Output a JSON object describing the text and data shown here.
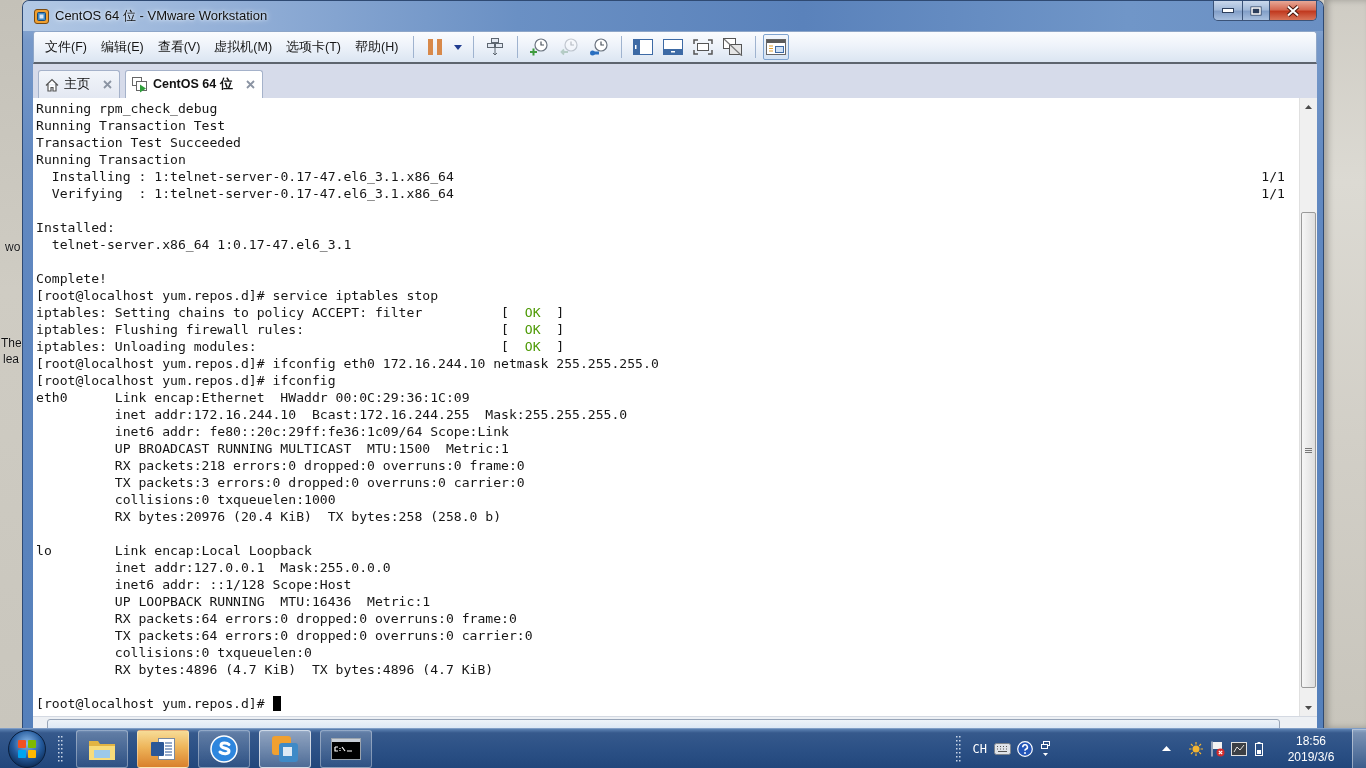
{
  "desktop": {
    "icon_labels": [
      "wo",
      "The",
      "lea"
    ]
  },
  "window": {
    "title": "CentOS 64 位 - VMware Workstation"
  },
  "menu": [
    {
      "label": "文件(F)"
    },
    {
      "label": "编辑(E)"
    },
    {
      "label": "查看(V)"
    },
    {
      "label": "虚拟机(M)"
    },
    {
      "label": "选项卡(T)"
    },
    {
      "label": "帮助(H)"
    }
  ],
  "toolbar": [
    {
      "items": [
        {
          "kind": "pause",
          "disabled": false,
          "pressed": false
        },
        {
          "kind": "dropdown",
          "disabled": false,
          "pressed": false
        }
      ]
    },
    {
      "items": [
        {
          "kind": "send-keys",
          "disabled": false,
          "pressed": false
        }
      ]
    },
    {
      "items": [
        {
          "kind": "snapshot-take",
          "disabled": false,
          "pressed": false
        },
        {
          "kind": "snapshot-revert",
          "disabled": true,
          "pressed": false
        },
        {
          "kind": "snapshot-manager",
          "disabled": false,
          "pressed": false
        }
      ]
    },
    {
      "items": [
        {
          "kind": "library",
          "disabled": false,
          "pressed": false
        },
        {
          "kind": "console",
          "disabled": false,
          "pressed": false
        },
        {
          "kind": "fullscreen",
          "disabled": false,
          "pressed": false
        },
        {
          "kind": "unity",
          "disabled": false,
          "pressed": false
        }
      ]
    },
    {
      "items": [
        {
          "kind": "thumbnails",
          "disabled": false,
          "pressed": true
        }
      ]
    }
  ],
  "tabs": [
    {
      "label": "主页",
      "kind": "home",
      "selected": false
    },
    {
      "label": "CentOS 64 位",
      "kind": "vm",
      "selected": true
    }
  ],
  "terminal": {
    "lines": [
      {
        "kind": "text",
        "text": "Running rpm_check_debug"
      },
      {
        "kind": "text",
        "text": "Running Transaction Test"
      },
      {
        "kind": "text",
        "text": "Transaction Test Succeeded"
      },
      {
        "kind": "text",
        "text": "Running Transaction"
      },
      {
        "kind": "progress",
        "text": "Installing : 1:telnet-server-0.17-47.el6_3.1.x86_64",
        "count": "1/1"
      },
      {
        "kind": "progress",
        "text": "Verifying  : 1:telnet-server-0.17-47.el6_3.1.x86_64",
        "count": "1/1"
      },
      {
        "kind": "blank"
      },
      {
        "kind": "text",
        "text": "Installed:"
      },
      {
        "kind": "item",
        "text": "telnet-server.x86_64 1:0.17-47.el6_3.1"
      },
      {
        "kind": "blank"
      },
      {
        "kind": "text",
        "text": "Complete!"
      },
      {
        "kind": "text",
        "text": "[root@localhost yum.repos.d]# service iptables stop"
      },
      {
        "kind": "status",
        "text": "iptables: Setting chains to policy ACCEPT: filter",
        "open": "[  ",
        "status": "OK",
        "close": "  ]"
      },
      {
        "kind": "status",
        "text": "iptables: Flushing firewall rules:",
        "open": "[  ",
        "status": "OK",
        "close": "  ]"
      },
      {
        "kind": "status",
        "text": "iptables: Unloading modules:",
        "open": "[  ",
        "status": "OK",
        "close": "  ]"
      },
      {
        "kind": "text",
        "text": "[root@localhost yum.repos.d]# ifconfig eth0 172.16.244.10 netmask 255.255.255.0"
      },
      {
        "kind": "text",
        "text": "[root@localhost yum.repos.d]# ifconfig"
      },
      {
        "kind": "interface",
        "name": "eth0",
        "lines": [
          "Link encap:Ethernet  HWaddr 00:0C:29:36:1C:09",
          "inet addr:172.16.244.10  Bcast:172.16.244.255  Mask:255.255.255.0",
          "inet6 addr: fe80::20c:29ff:fe36:1c09/64 Scope:Link",
          "UP BROADCAST RUNNING MULTICAST  MTU:1500  Metric:1",
          "RX packets:218 errors:0 dropped:0 overruns:0 frame:0",
          "TX packets:3 errors:0 dropped:0 overruns:0 carrier:0",
          "collisions:0 txqueuelen:1000",
          "RX bytes:20976 (20.4 KiB)  TX bytes:258 (258.0 b)"
        ]
      },
      {
        "kind": "blank"
      },
      {
        "kind": "interface",
        "name": "lo",
        "lines": [
          "Link encap:Local Loopback",
          "inet addr:127.0.0.1  Mask:255.0.0.0",
          "inet6 addr: ::1/128 Scope:Host",
          "UP LOOPBACK RUNNING  MTU:16436  Metric:1",
          "RX packets:64 errors:0 dropped:0 overruns:0 frame:0",
          "TX packets:64 errors:0 dropped:0 overruns:0 carrier:0",
          "collisions:0 txqueuelen:0",
          "RX bytes:4896 (4.7 KiB)  TX bytes:4896 (4.7 KiB)"
        ]
      },
      {
        "kind": "blank"
      },
      {
        "kind": "input",
        "text": "[root@localhost yum.repos.d]#"
      }
    ]
  },
  "taskbar": {
    "apps": [
      {
        "kind": "explorer",
        "active": false,
        "flashing": false
      },
      {
        "kind": "word",
        "active": false,
        "flashing": true
      },
      {
        "kind": "sogou",
        "active": false,
        "flashing": false
      },
      {
        "kind": "vmware",
        "active": true,
        "flashing": false
      },
      {
        "kind": "cmd",
        "active": false,
        "flashing": false
      }
    ],
    "language": "CH",
    "clock": {
      "time": "18:56",
      "date": "2019/3/6"
    }
  }
}
